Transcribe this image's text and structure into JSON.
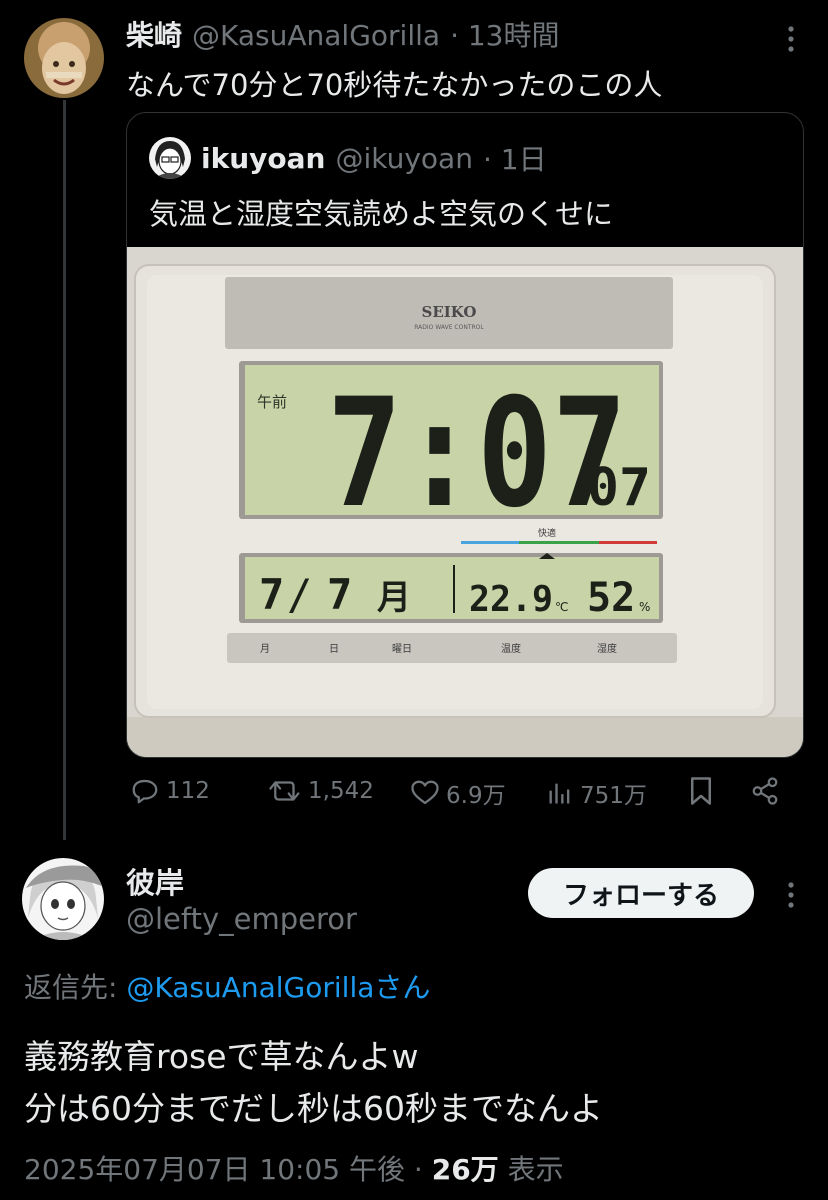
{
  "main_tweet": {
    "name": "柴崎",
    "handle": "@KasuAnalGorilla",
    "time": "· 13時間",
    "text": "なんで70分と70秒待たなかったのこの人"
  },
  "quoted_tweet": {
    "name": "ikuyoan",
    "handle": "@ikuyoan",
    "time": "· 1日",
    "text": "気温と湿度空気読めよ空気のくせに",
    "clock": {
      "brand": "SEIKO",
      "brand_sub": "RADIO WAVE CONTROL",
      "am_label": "午前",
      "time": "7:07",
      "seconds": "07",
      "month": "7",
      "day": "7",
      "weekday": "月",
      "temperature": "22.9",
      "temp_unit": "℃",
      "humidity": "52",
      "humidity_unit": "%",
      "comfort_label": "快適",
      "labels": [
        "月",
        "日",
        "曜日",
        "温度",
        "湿度"
      ]
    }
  },
  "actions": {
    "replies": "112",
    "reposts": "1,542",
    "likes": "6.9万",
    "views": "751万"
  },
  "reply_tweet": {
    "name": "彼岸",
    "handle": "@lefty_emperor",
    "follow_label": "フォローする",
    "reply_to_prefix": "返信先: ",
    "reply_to_handle": "@KasuAnalGorilla",
    "reply_to_suffix": "さん",
    "line1": "義務教育roseで草なんよw",
    "line2": "分は60分までだし秒は60秒までなんよ",
    "timestamp": "2025年07月07日 10:05 午後",
    "separator": " · ",
    "views_count": "26万",
    "views_label": " 表示"
  },
  "colors": {
    "background": "#000000",
    "text": "#e7e9ea",
    "muted": "#71767b",
    "link": "#1d9bf0",
    "lcd": "#c9d3a8"
  }
}
